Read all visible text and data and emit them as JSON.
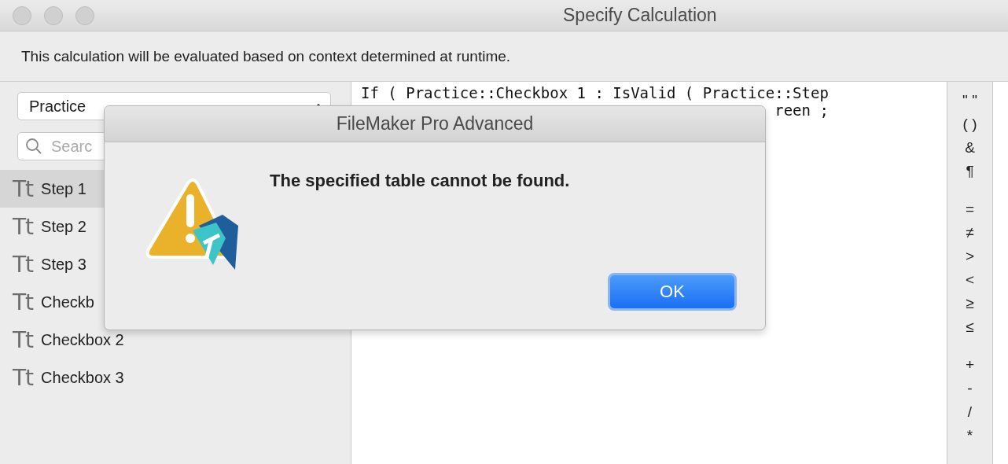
{
  "window": {
    "title": "Specify Calculation"
  },
  "info": "This calculation will be evaluated based on context determined at runtime.",
  "table_select": {
    "value": "Practice"
  },
  "search": {
    "placeholder": "Searc"
  },
  "fields": [
    {
      "icon_text": "Tt",
      "label": "Step 1",
      "selected": true
    },
    {
      "icon_text": "Tt",
      "label": "Step 2",
      "selected": false
    },
    {
      "icon_text": "Tt",
      "label": "Step 3",
      "selected": false
    },
    {
      "icon_text": "Tt",
      "label": "Checkb",
      "selected": false
    },
    {
      "icon_text": "Tt",
      "label": "Checkbox 2",
      "selected": false
    },
    {
      "icon_text": "Tt",
      "label": "Checkbox 3",
      "selected": false
    }
  ],
  "formula": {
    "line_1": "If ( Practice::Checkbox 1 : IsValid ( Practice::Step",
    "line_2": "reen ;"
  },
  "operator_groups": [
    [
      "\" \"",
      "( )",
      "&",
      "¶"
    ],
    [
      "=",
      "≠",
      ">",
      "<",
      "≥",
      "≤"
    ],
    [
      "+",
      "-",
      "/",
      "*"
    ]
  ],
  "dialog": {
    "title": "FileMaker Pro Advanced",
    "message": "The specified table cannot be found.",
    "button": "OK"
  }
}
